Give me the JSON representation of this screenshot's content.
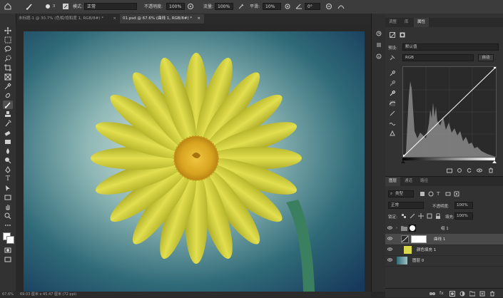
{
  "options_bar": {
    "brush_size": "3",
    "mode_label": "模式:",
    "mode_value": "正常",
    "opacity_label": "不透明度:",
    "opacity_value": "100%",
    "flow_label": "流量:",
    "flow_value": "100%",
    "smoothing_label": "平滑:",
    "smoothing_value": "10%",
    "angle_value": "0°"
  },
  "tabs": [
    {
      "label": "未标题-1 @ 30.7% (色相/饱和度 1, RGB/8#) *",
      "active": false
    },
    {
      "label": "01.psd @ 67.6% (曲线 1, RGB/8#) *",
      "active": true
    }
  ],
  "status_bar": {
    "zoom": "67.6%",
    "doc_size": "69.03 厘米 x 45.47 厘米 (72 ppi)"
  },
  "adjust_panel": {
    "tabs": [
      "调整",
      "库",
      "属性"
    ],
    "preset_label": "预设:",
    "preset_value": "默认值",
    "channel_value": "RGB",
    "auto_button": "自动"
  },
  "layers_panel": {
    "tabs": [
      "图层",
      "通道",
      "路径"
    ],
    "filter_value": "类型",
    "blend_mode": "正常",
    "opacity_label": "不透明度:",
    "opacity_value": "100%",
    "lock_label": "锁定:",
    "fill_label": "填充:",
    "fill_value": "100%",
    "layers": [
      {
        "name": "组 1",
        "type": "group",
        "selected": false
      },
      {
        "name": "曲线 1",
        "type": "curves",
        "selected": true
      },
      {
        "name": "颜色填充 1",
        "type": "fill",
        "selected": false
      },
      {
        "name": "图层 0",
        "type": "image",
        "selected": false
      }
    ]
  },
  "colors": {
    "accent": "#d8d84a",
    "panel_bg": "#323232",
    "selected_layer": "#4a4a4a"
  }
}
